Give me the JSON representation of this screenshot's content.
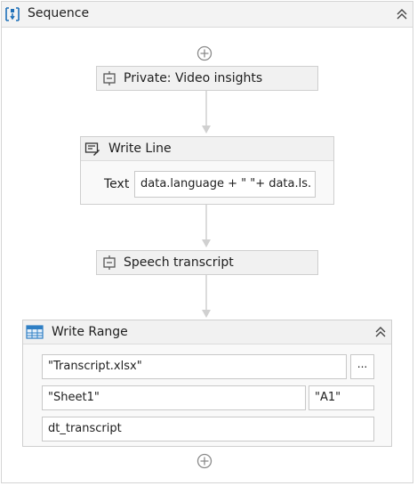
{
  "sequence": {
    "title": "Sequence",
    "collapse_icon": "double-chevron-up-icon"
  },
  "activities": {
    "video_insights": {
      "title": "Private: Video insights",
      "icon": "invoke-workflow-icon"
    },
    "write_line": {
      "title": "Write Line",
      "icon": "write-line-icon",
      "text_label": "Text",
      "text_value": "data.language + \"  \"+ data.ls."
    },
    "speech_transcript": {
      "title": "Speech transcript",
      "icon": "invoke-workflow-icon"
    },
    "write_range": {
      "title": "Write Range",
      "icon": "excel-range-icon",
      "collapse_icon": "double-chevron-up-icon",
      "workbook_path": "\"Transcript.xlsx\"",
      "browse_label": "...",
      "sheet_name": "\"Sheet1\"",
      "start_cell": "\"A1\"",
      "data_table": "dt_transcript"
    }
  },
  "add_activity_icon": "plus-circle-icon",
  "colors": {
    "header_bg": "#f3f3f3",
    "activity_bg": "#f1f1f1",
    "border": "#cfcfcf",
    "connector": "#d0d0d0",
    "icon_blue": "#1d6fb8"
  }
}
